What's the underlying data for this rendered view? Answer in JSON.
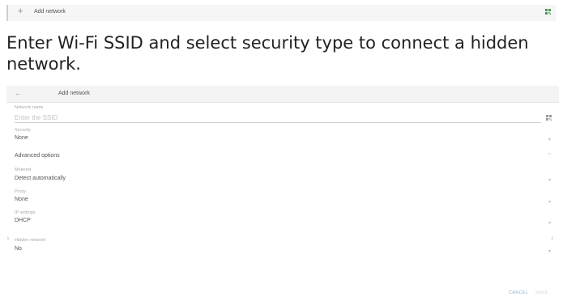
{
  "topbar": {
    "plus": "+",
    "label": "Add network"
  },
  "headline": "Enter Wi-Fi SSID and select security type to connect a hidden network.",
  "panel": {
    "back": "←",
    "title": "Add network",
    "network_name_label": "Network name",
    "ssid_placeholder": "Enter the SSID",
    "security_label": "Security",
    "security_value": "None",
    "advanced_label": "Advanced options",
    "metered_label": "Metered",
    "metered_value": "Detect automatically",
    "proxy_label": "Proxy",
    "proxy_value": "None",
    "ip_label": "IP settings",
    "ip_value": "DHCP",
    "hidden_label": "Hidden network",
    "hidden_value": "No",
    "cancel_label": "CANCEL",
    "save_label": "SAVE"
  }
}
